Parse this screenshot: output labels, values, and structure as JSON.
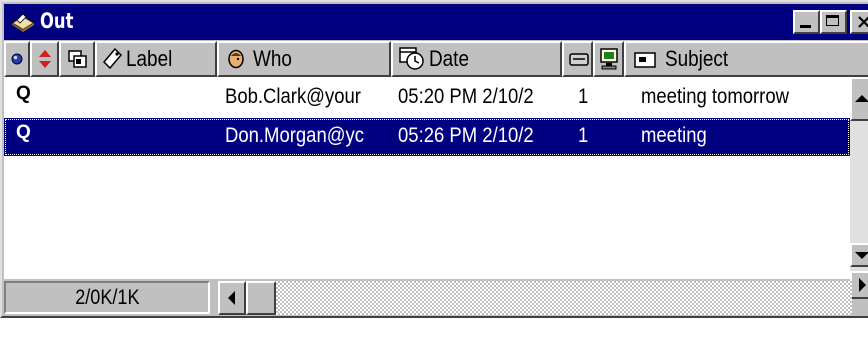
{
  "window": {
    "title": "Out",
    "controls": [
      "minimize",
      "maximize",
      "close"
    ]
  },
  "columns": {
    "status": {
      "icon": "status-dot-icon"
    },
    "priority": {
      "icon": "priority-arrows-icon"
    },
    "attachment": {
      "icon": "attachment-icon"
    },
    "label": {
      "icon": "tag-icon",
      "label": "Label"
    },
    "who": {
      "icon": "person-icon",
      "label": "Who"
    },
    "date": {
      "icon": "clock-calendar-icon",
      "label": "Date"
    },
    "size": {
      "icon": "size-icon"
    },
    "server": {
      "icon": "server-icon"
    },
    "subject": {
      "icon": "envelope-icon",
      "label": "Subject"
    }
  },
  "messages": [
    {
      "status": "Q",
      "who": "Bob.Clark@your",
      "date": "05:20 PM 2/10/2",
      "size": "1",
      "subject": "meeting tomorrow",
      "selected": false
    },
    {
      "status": "Q",
      "who": "Don.Morgan@yc",
      "date": "05:26 PM 2/10/2",
      "size": "1",
      "subject": "meeting",
      "selected": true
    }
  ],
  "statusbar": {
    "counts": "2/0K/1K"
  },
  "colors": {
    "title_bar": "#000080",
    "selection": "#000080",
    "face": "#c0c0c0"
  }
}
